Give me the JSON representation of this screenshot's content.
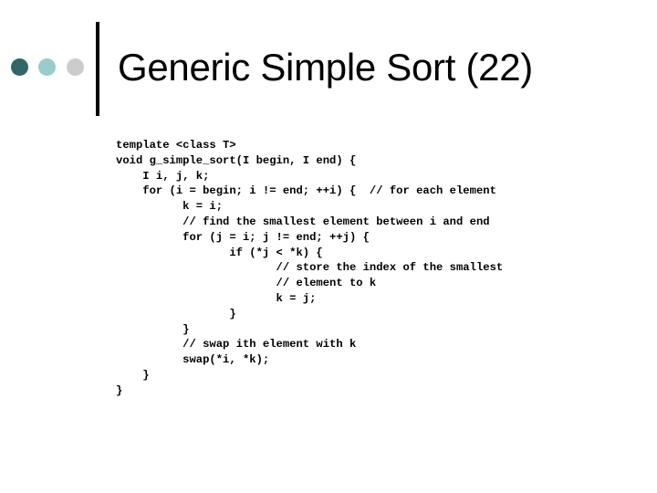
{
  "slide": {
    "title": "Generic Simple Sort (22)",
    "decoration": {
      "dots": [
        "#336666",
        "#99cccc",
        "#cccccc"
      ],
      "bar_color": "#000000"
    },
    "code_lines": [
      "template <class T>",
      "void g_simple_sort(I begin, I end) {",
      "    I i, j, k;",
      "    for (i = begin; i != end; ++i) {  // for each element",
      "          k = i;",
      "          // find the smallest element between i and end",
      "          for (j = i; j != end; ++j) {",
      "                 if (*j < *k) {",
      "                        // store the index of the smallest",
      "                        // element to k",
      "                        k = j;",
      "                 }",
      "          }",
      "          // swap ith element with k",
      "          swap(*i, *k);",
      "    }",
      "}"
    ]
  }
}
